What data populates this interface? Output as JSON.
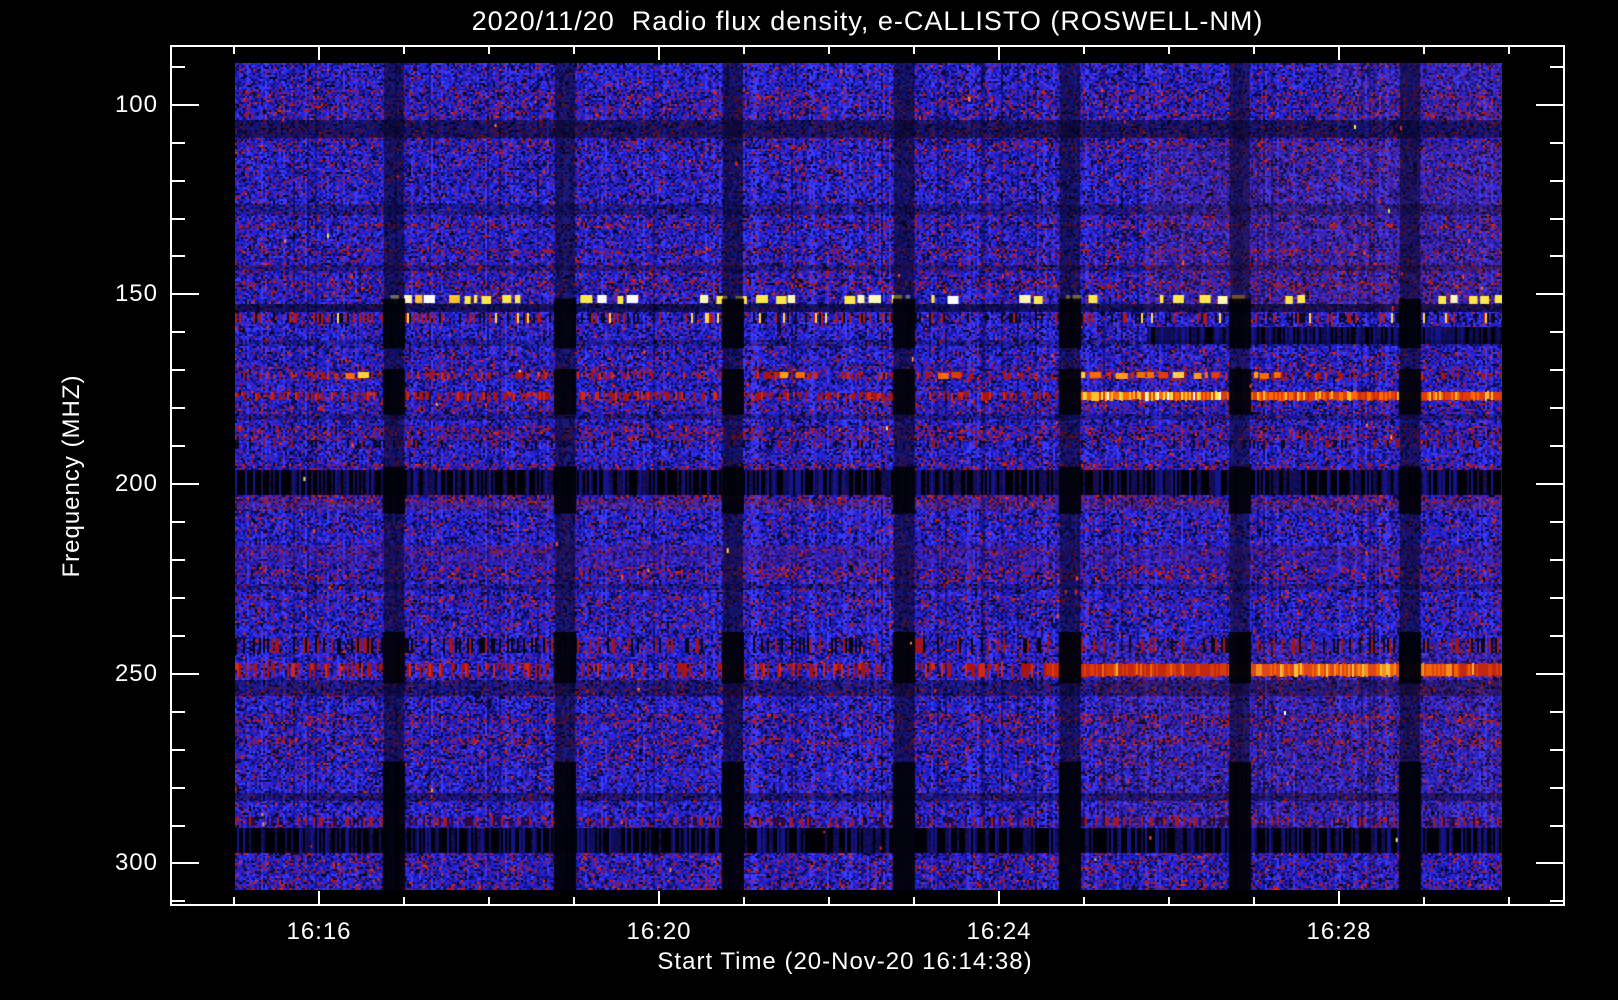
{
  "window": {
    "background": "#000000"
  },
  "chart_data": {
    "type": "heatmap",
    "title": "2020/11/20  Radio flux density, e-CALLISTO (ROSWELL-NM)",
    "xlabel": "Start Time (20-Nov-20 16:14:38)",
    "ylabel": "Frequency (MHZ)",
    "date": "2020/11/20",
    "instrument": "e-CALLISTO",
    "station": "ROSWELL-NM",
    "start_time": "20-Nov-20 16:14:38",
    "legend": "none",
    "grid": "off",
    "x_axis": {
      "unit": "time (HH:MM)",
      "major_labels": [
        "16:16",
        "16:20",
        "16:24",
        "16:28"
      ],
      "first_major_s": 960,
      "major_step_s": 240,
      "minor_step_s": 60,
      "tick_start_s": 900,
      "tick_end_s": 1800,
      "data_start_s": 901,
      "data_end_s": 1795,
      "epoch": "16:00:00"
    },
    "y_axis": {
      "unit": "MHz",
      "major_ticks": [
        100,
        150,
        200,
        250,
        300
      ],
      "minor_step": 10,
      "tick_min": 90,
      "tick_max": 310,
      "min_mhz": 89,
      "max_mhz": 307,
      "inverted": true
    },
    "rfi_lines_mhz": [
      107,
      151,
      155,
      172,
      177,
      200,
      207,
      220,
      245,
      248,
      290
    ],
    "palette": {
      "blue": "#2424d8",
      "bright_blue": "#3b3bff",
      "deep_blue": "#1616a2",
      "navy": "#0c0c52",
      "purple": "#5a1ea2",
      "magenta": "#8c1c44",
      "red": "#b81818",
      "bright_red": "#e03010",
      "black": "#04040f",
      "yellow": "#ffe84a",
      "white": "#ffffff",
      "orange": "#ff6a00"
    },
    "features": [
      {
        "type": "dark",
        "y": [
          0.069,
          0.091
        ],
        "alpha": 0.5
      },
      {
        "type": "dark",
        "y": [
          0.17,
          0.184
        ],
        "alpha": 0.28
      },
      {
        "type": "dark",
        "y": [
          0.244,
          0.252
        ],
        "alpha": 0.28
      },
      {
        "type": "tint",
        "x": [
          0.72,
          1.0
        ],
        "y": [
          0.095,
          0.3
        ],
        "color": "rgba(150,50,40,0.13)"
      },
      {
        "type": "tint",
        "x": [
          0.86,
          1.0
        ],
        "y": [
          0.0,
          0.07
        ],
        "color": "rgba(150,50,40,0.10)"
      },
      {
        "type": "dashes",
        "palette": "yellow",
        "y": [
          0.281,
          0.291
        ],
        "segments": [
          [
            0.118,
            0.225,
            0.45
          ],
          [
            0.268,
            0.324,
            0.3
          ],
          [
            0.367,
            0.454,
            0.5
          ],
          [
            0.481,
            0.53,
            0.85
          ],
          [
            0.545,
            0.568,
            0.55
          ],
          [
            0.616,
            0.687,
            0.45
          ],
          [
            0.73,
            0.797,
            0.45
          ],
          [
            0.829,
            0.852,
            0.35
          ],
          [
            0.947,
            0.998,
            0.7
          ]
        ]
      },
      {
        "type": "dark",
        "y": [
          0.292,
          0.301
        ],
        "alpha": 0.6
      },
      {
        "type": "speckle",
        "y": [
          0.302,
          0.314
        ],
        "density": 0.3,
        "colors": [
          "#b01818",
          "#ffd84a",
          "#0a0a20"
        ],
        "weights": [
          0.45,
          0.1,
          0.45
        ]
      },
      {
        "type": "barcode",
        "x": [
          0.72,
          1.0
        ],
        "y": [
          0.319,
          0.34
        ],
        "density": 0.3
      },
      {
        "type": "dark",
        "y": [
          0.335,
          0.342
        ],
        "alpha": 0.25
      },
      {
        "type": "redline",
        "y": [
          0.374,
          0.382
        ],
        "density": 0.28
      },
      {
        "type": "dashes",
        "palette": "orange",
        "y": [
          0.374,
          0.382
        ],
        "segments": [
          [
            0.083,
            0.099,
            0.6
          ],
          [
            0.43,
            0.446,
            0.5
          ],
          [
            0.541,
            0.576,
            0.45
          ],
          [
            0.657,
            0.687,
            0.6
          ],
          [
            0.695,
            0.829,
            0.6
          ]
        ]
      },
      {
        "type": "redline",
        "y": [
          0.398,
          0.407
        ],
        "density": 0.5
      },
      {
        "type": "hotline",
        "style": "yellow",
        "y": [
          0.398,
          0.407
        ],
        "x": [
          0.657,
          1.0
        ],
        "hot": [
          0.66,
          0.79
        ]
      },
      {
        "type": "dark",
        "y": [
          0.425,
          0.432
        ],
        "alpha": 0.28
      },
      {
        "type": "speckle",
        "y": [
          0.456,
          0.466
        ],
        "density": 0.22,
        "colors": [
          "#8c1428",
          "#0a0a24"
        ],
        "weights": [
          0.45,
          0.55
        ]
      },
      {
        "type": "barcode",
        "y": [
          0.492,
          0.522
        ],
        "density": 0.5
      },
      {
        "type": "tint",
        "y": [
          0.528,
          0.54
        ],
        "color": "rgba(150,35,30,0.22)"
      },
      {
        "type": "purple",
        "y": [
          0.583,
          0.608
        ],
        "alpha": 0.26
      },
      {
        "type": "dark",
        "y": [
          0.63,
          0.637
        ],
        "alpha": 0.22
      },
      {
        "type": "speckle",
        "y": [
          0.695,
          0.713
        ],
        "density": 0.28,
        "colors": [
          "#a01420",
          "#05051a"
        ],
        "weights": [
          0.4,
          0.6
        ]
      },
      {
        "type": "redline",
        "y": [
          0.726,
          0.742
        ],
        "density": 0.42
      },
      {
        "type": "hotline",
        "style": "red",
        "y": [
          0.727,
          0.741
        ],
        "x": [
          0.64,
          1.0
        ],
        "hot": [
          0.79,
          0.96
        ]
      },
      {
        "type": "dark",
        "y": [
          0.746,
          0.765
        ],
        "alpha": 0.35
      },
      {
        "type": "tint",
        "x": [
          0.68,
          1.0
        ],
        "y": [
          0.7,
          0.93
        ],
        "color": "rgba(140,45,40,0.10)"
      },
      {
        "type": "dark",
        "y": [
          0.883,
          0.892
        ],
        "alpha": 0.4
      },
      {
        "type": "speckle",
        "y": [
          0.912,
          0.923
        ],
        "density": 0.3,
        "colors": [
          "#a01830",
          "#30083a"
        ],
        "weights": [
          0.5,
          0.5
        ]
      },
      {
        "type": "barcode",
        "y": [
          0.925,
          0.955
        ],
        "density": 0.55
      }
    ],
    "calibration_gaps": {
      "centers": [
        0.1255,
        0.2605,
        0.393,
        0.528,
        0.659,
        0.7932,
        0.9274
      ],
      "width": 0.016,
      "times": [
        "16:16:54",
        "16:18:54",
        "16:20:55",
        "16:22:55",
        "16:24:51",
        "16:26:54",
        "16:28:53"
      ],
      "black_segments": [
        [
          0.285,
          0.345
        ],
        [
          0.37,
          0.425
        ],
        [
          0.488,
          0.545
        ],
        [
          0.688,
          0.75
        ],
        [
          0.845,
          1.0
        ]
      ]
    },
    "specks": [
      {
        "x": 0.0923,
        "y": 0.2576,
        "c": "#ff3020"
      },
      {
        "x": 0.4404,
        "y": 0.2576,
        "c": "#e02010"
      },
      {
        "x": 0.606,
        "y": 0.2564,
        "c": "#ff3020"
      },
      {
        "x": 0.6401,
        "y": 0.2576,
        "c": "#d02010"
      },
      {
        "x": 0.9693,
        "y": 0.2576,
        "c": "#ff4030"
      },
      {
        "x": 0.9108,
        "y": 0.1777,
        "c": "#cddd30"
      },
      {
        "x": 0.8287,
        "y": 0.7848,
        "c": "#ffffff"
      },
      {
        "x": 0.884,
        "y": 0.0762,
        "c": "#ffe84a"
      },
      {
        "x": 0.1554,
        "y": 0.8784,
        "c": "#ffa020"
      },
      {
        "x": 0.3437,
        "y": 0.9746,
        "c": "#ff8020"
      }
    ],
    "noise_specks": 90
  }
}
